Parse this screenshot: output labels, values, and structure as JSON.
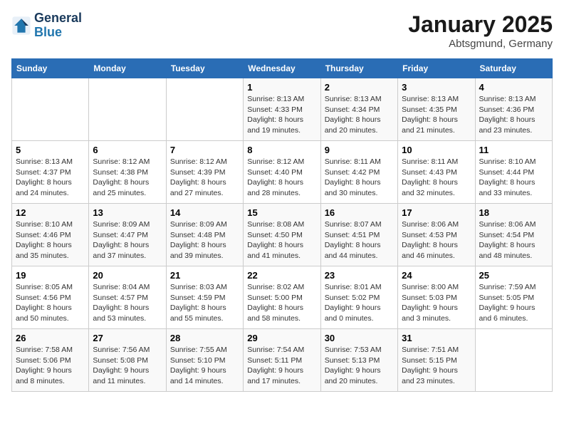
{
  "logo": {
    "line1": "General",
    "line2": "Blue"
  },
  "title": "January 2025",
  "subtitle": "Abtsgmund, Germany",
  "headers": [
    "Sunday",
    "Monday",
    "Tuesday",
    "Wednesday",
    "Thursday",
    "Friday",
    "Saturday"
  ],
  "weeks": [
    [
      {
        "day": "",
        "info": ""
      },
      {
        "day": "",
        "info": ""
      },
      {
        "day": "",
        "info": ""
      },
      {
        "day": "1",
        "info": "Sunrise: 8:13 AM\nSunset: 4:33 PM\nDaylight: 8 hours\nand 19 minutes."
      },
      {
        "day": "2",
        "info": "Sunrise: 8:13 AM\nSunset: 4:34 PM\nDaylight: 8 hours\nand 20 minutes."
      },
      {
        "day": "3",
        "info": "Sunrise: 8:13 AM\nSunset: 4:35 PM\nDaylight: 8 hours\nand 21 minutes."
      },
      {
        "day": "4",
        "info": "Sunrise: 8:13 AM\nSunset: 4:36 PM\nDaylight: 8 hours\nand 23 minutes."
      }
    ],
    [
      {
        "day": "5",
        "info": "Sunrise: 8:13 AM\nSunset: 4:37 PM\nDaylight: 8 hours\nand 24 minutes."
      },
      {
        "day": "6",
        "info": "Sunrise: 8:12 AM\nSunset: 4:38 PM\nDaylight: 8 hours\nand 25 minutes."
      },
      {
        "day": "7",
        "info": "Sunrise: 8:12 AM\nSunset: 4:39 PM\nDaylight: 8 hours\nand 27 minutes."
      },
      {
        "day": "8",
        "info": "Sunrise: 8:12 AM\nSunset: 4:40 PM\nDaylight: 8 hours\nand 28 minutes."
      },
      {
        "day": "9",
        "info": "Sunrise: 8:11 AM\nSunset: 4:42 PM\nDaylight: 8 hours\nand 30 minutes."
      },
      {
        "day": "10",
        "info": "Sunrise: 8:11 AM\nSunset: 4:43 PM\nDaylight: 8 hours\nand 32 minutes."
      },
      {
        "day": "11",
        "info": "Sunrise: 8:10 AM\nSunset: 4:44 PM\nDaylight: 8 hours\nand 33 minutes."
      }
    ],
    [
      {
        "day": "12",
        "info": "Sunrise: 8:10 AM\nSunset: 4:46 PM\nDaylight: 8 hours\nand 35 minutes."
      },
      {
        "day": "13",
        "info": "Sunrise: 8:09 AM\nSunset: 4:47 PM\nDaylight: 8 hours\nand 37 minutes."
      },
      {
        "day": "14",
        "info": "Sunrise: 8:09 AM\nSunset: 4:48 PM\nDaylight: 8 hours\nand 39 minutes."
      },
      {
        "day": "15",
        "info": "Sunrise: 8:08 AM\nSunset: 4:50 PM\nDaylight: 8 hours\nand 41 minutes."
      },
      {
        "day": "16",
        "info": "Sunrise: 8:07 AM\nSunset: 4:51 PM\nDaylight: 8 hours\nand 44 minutes."
      },
      {
        "day": "17",
        "info": "Sunrise: 8:06 AM\nSunset: 4:53 PM\nDaylight: 8 hours\nand 46 minutes."
      },
      {
        "day": "18",
        "info": "Sunrise: 8:06 AM\nSunset: 4:54 PM\nDaylight: 8 hours\nand 48 minutes."
      }
    ],
    [
      {
        "day": "19",
        "info": "Sunrise: 8:05 AM\nSunset: 4:56 PM\nDaylight: 8 hours\nand 50 minutes."
      },
      {
        "day": "20",
        "info": "Sunrise: 8:04 AM\nSunset: 4:57 PM\nDaylight: 8 hours\nand 53 minutes."
      },
      {
        "day": "21",
        "info": "Sunrise: 8:03 AM\nSunset: 4:59 PM\nDaylight: 8 hours\nand 55 minutes."
      },
      {
        "day": "22",
        "info": "Sunrise: 8:02 AM\nSunset: 5:00 PM\nDaylight: 8 hours\nand 58 minutes."
      },
      {
        "day": "23",
        "info": "Sunrise: 8:01 AM\nSunset: 5:02 PM\nDaylight: 9 hours\nand 0 minutes."
      },
      {
        "day": "24",
        "info": "Sunrise: 8:00 AM\nSunset: 5:03 PM\nDaylight: 9 hours\nand 3 minutes."
      },
      {
        "day": "25",
        "info": "Sunrise: 7:59 AM\nSunset: 5:05 PM\nDaylight: 9 hours\nand 6 minutes."
      }
    ],
    [
      {
        "day": "26",
        "info": "Sunrise: 7:58 AM\nSunset: 5:06 PM\nDaylight: 9 hours\nand 8 minutes."
      },
      {
        "day": "27",
        "info": "Sunrise: 7:56 AM\nSunset: 5:08 PM\nDaylight: 9 hours\nand 11 minutes."
      },
      {
        "day": "28",
        "info": "Sunrise: 7:55 AM\nSunset: 5:10 PM\nDaylight: 9 hours\nand 14 minutes."
      },
      {
        "day": "29",
        "info": "Sunrise: 7:54 AM\nSunset: 5:11 PM\nDaylight: 9 hours\nand 17 minutes."
      },
      {
        "day": "30",
        "info": "Sunrise: 7:53 AM\nSunset: 5:13 PM\nDaylight: 9 hours\nand 20 minutes."
      },
      {
        "day": "31",
        "info": "Sunrise: 7:51 AM\nSunset: 5:15 PM\nDaylight: 9 hours\nand 23 minutes."
      },
      {
        "day": "",
        "info": ""
      }
    ]
  ]
}
